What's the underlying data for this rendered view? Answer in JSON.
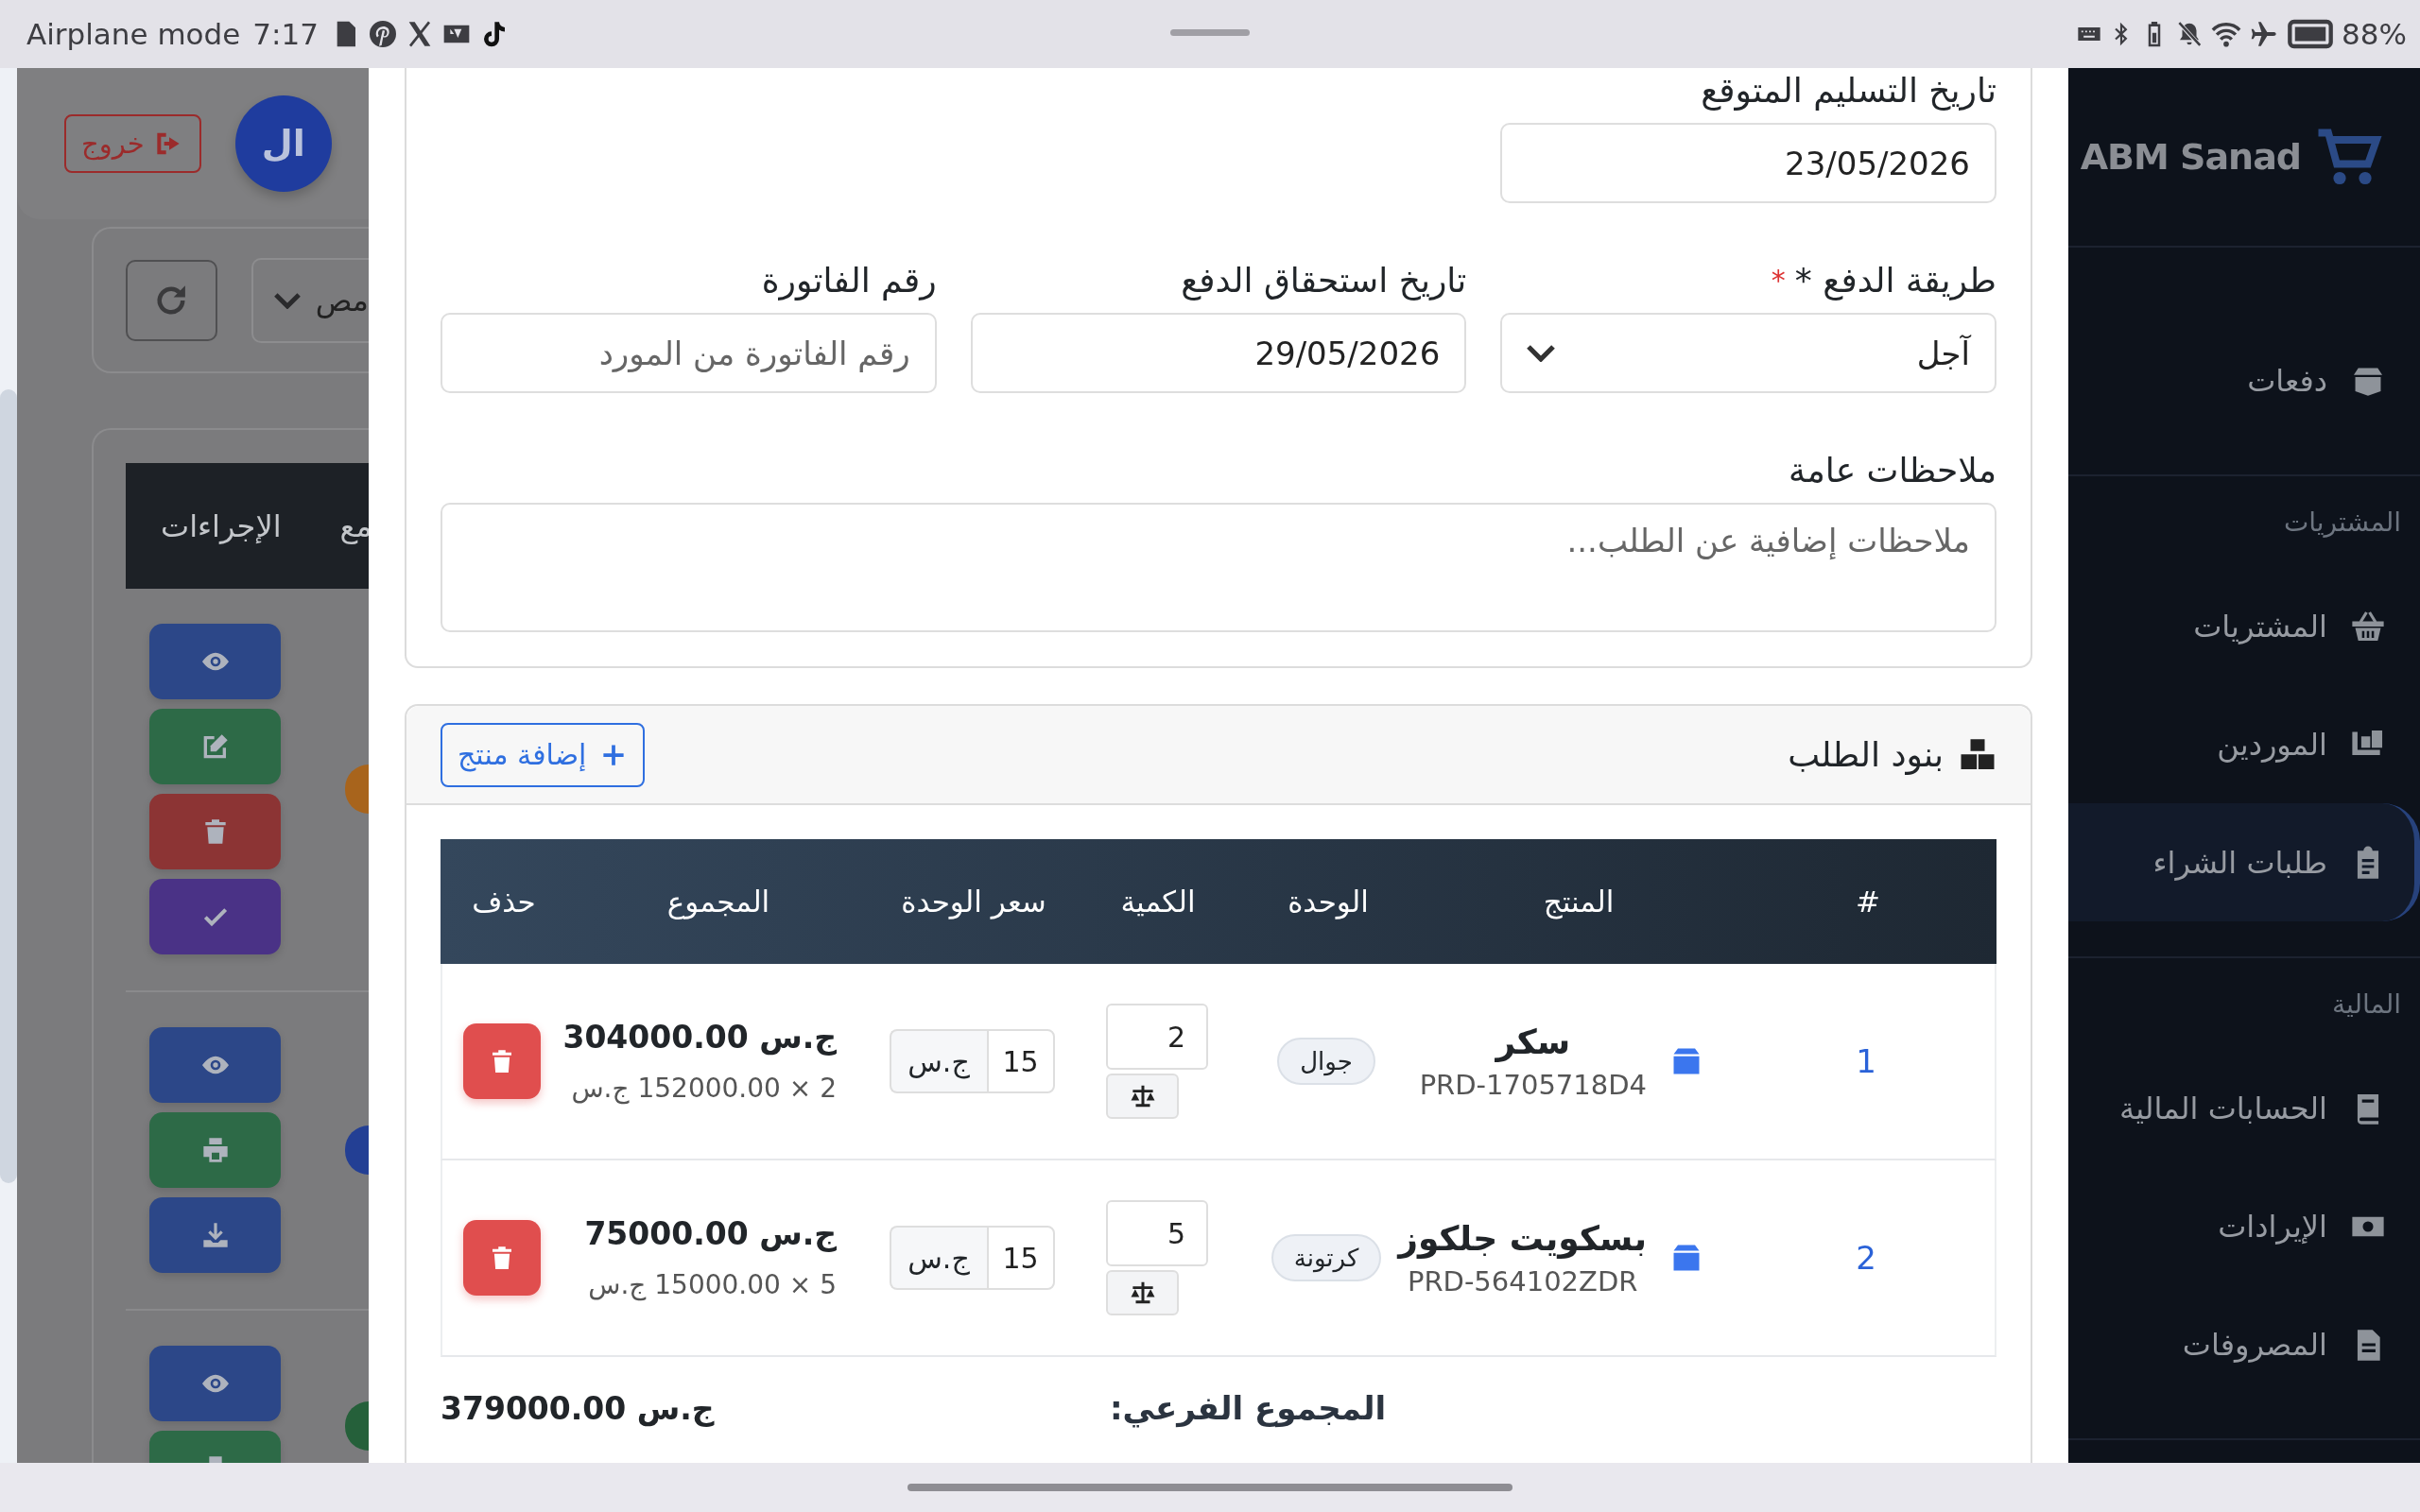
{
  "status_bar": {
    "mode": "Airplane mode",
    "time": "7:17",
    "battery": "88%"
  },
  "background_page": {
    "logout_button": "خروج",
    "avatar": "ال",
    "filter_text": "مص",
    "table_headers": [
      "مع",
      "الإجراءات"
    ],
    "action_groups": [
      {
        "color": "#a8641c",
        "actions": [
          {
            "kind": "view"
          },
          {
            "kind": "edit"
          },
          {
            "kind": "delete"
          },
          {
            "kind": "approve"
          }
        ]
      },
      {
        "color": "#233f94",
        "actions": [
          {
            "kind": "view"
          },
          {
            "kind": "print"
          },
          {
            "kind": "download"
          }
        ]
      },
      {
        "color": "#25603a",
        "actions": [
          {
            "kind": "view"
          },
          {
            "kind": "print"
          }
        ]
      }
    ]
  },
  "modal": {
    "form_rows": [
      [
        {
          "label": "تاريخ التسليم المتوقع",
          "kind": "date",
          "value": "23/05/2026"
        }
      ],
      [
        {
          "label": "طريقة الدفع *",
          "kind": "select",
          "value": "آجل",
          "required": true,
          "required_mark": "*"
        },
        {
          "label": "تاريخ استحقاق الدفع",
          "kind": "date",
          "value": "29/05/2026"
        },
        {
          "label": "رقم الفاتورة",
          "kind": "text",
          "placeholder": "رقم الفاتورة من المورد"
        }
      ]
    ],
    "notes": {
      "label": "ملاحظات عامة",
      "placeholder": "ملاحظات إضافية عن الطلب..."
    },
    "items": {
      "title": "بنود الطلب",
      "add_button": "إضافة منتج",
      "columns": [
        "#",
        "المنتج",
        "الوحدة",
        "الكمية",
        "سعر الوحدة",
        "المجموع",
        "حذف"
      ],
      "rows": [
        {
          "index": "1",
          "name": "سكر",
          "code": "PRD-1705718D4",
          "unit": "جوال",
          "quantity": "2",
          "price": "15",
          "currency": "ج.س",
          "total": "304000.00 ج.س",
          "breakdown": "2 × 152000.00 ج.س"
        },
        {
          "index": "2",
          "name": "بسكويت جلكوز",
          "code": "PRD-564102ZDR",
          "unit": "كرتونة",
          "quantity": "5",
          "price": "15",
          "currency": "ج.س",
          "total": "75000.00 ج.س",
          "breakdown": "5 × 15000.00 ج.س"
        }
      ],
      "subtotal_label": "المجموع الفرعي:",
      "subtotal": "379000.00 ج.س"
    }
  },
  "sidebar": {
    "brand": "ABM Sanad",
    "sections": [
      {
        "items": [
          {
            "label": "دفعات",
            "kind": "box",
            "selected": false
          }
        ]
      },
      {
        "title": "المشتريات",
        "items": [
          {
            "label": "المشتريات",
            "kind": "basket",
            "selected": false
          },
          {
            "label": "الموردين",
            "kind": "dolly",
            "selected": false
          },
          {
            "label": "طلبات الشراء",
            "kind": "clipboard",
            "selected": true
          }
        ]
      },
      {
        "title": "المالية",
        "items": [
          {
            "label": "الحسابات المالية",
            "kind": "book",
            "selected": false
          },
          {
            "label": "الإيرادات",
            "kind": "money",
            "selected": false
          },
          {
            "label": "المصروفات",
            "kind": "document",
            "selected": false
          }
        ]
      }
    ]
  }
}
